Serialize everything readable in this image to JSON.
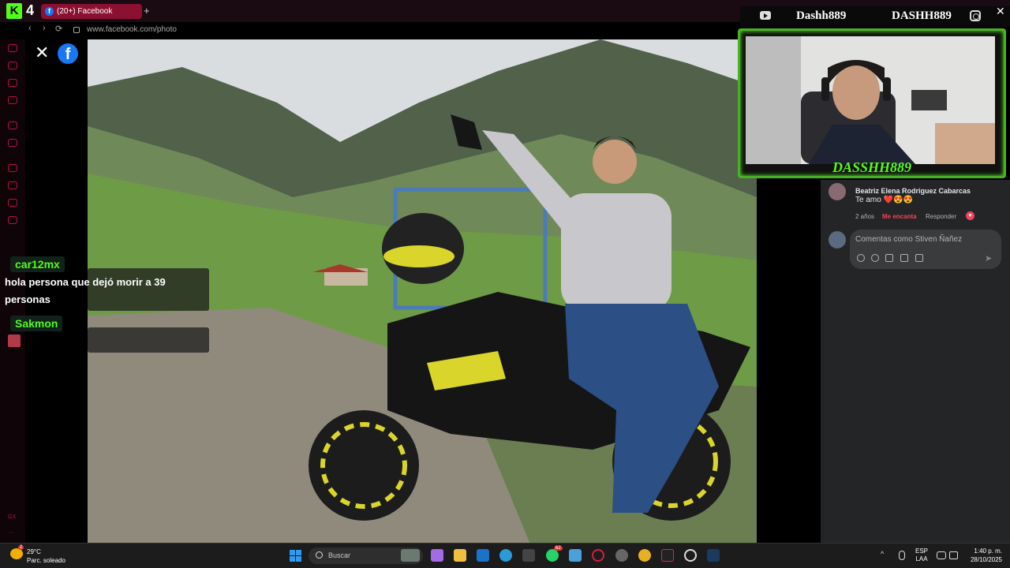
{
  "browser": {
    "brand_letter": "K",
    "brand_number": "4",
    "tab_title": "(20+) Facebook",
    "tab_plus": "+",
    "url": "www.facebook.com/photo",
    "nav_back": "‹",
    "nav_forward": "›",
    "nav_reload": "⟳"
  },
  "rail": {
    "bottom_label": "GX",
    "more_label": "···"
  },
  "facebook": {
    "close_glyph": "✕",
    "logo_letter": "f",
    "comment": {
      "author": "Beatriz Elena Rodriguez Cabarcas",
      "text": "Te amo ❤️😍😍",
      "time": "2 años",
      "reaction": "Me encanta",
      "reply": "Responder",
      "badge": "♥"
    },
    "composer": {
      "placeholder": "Comentas como Stiven Ñañez",
      "send_glyph": "➤"
    }
  },
  "chat": {
    "messages": [
      {
        "user": "car12mx",
        "text": "hola persona que dejó morir a 39 personas"
      },
      {
        "user": "Sakmon",
        "text": ""
      }
    ]
  },
  "stream_overlay": {
    "youtube_handle": "Dashh889",
    "instagram_handle": "DASHH889",
    "cam_label": "DASSHH889",
    "close_glyph": "✕"
  },
  "taskbar": {
    "weather_temp": "29°C",
    "weather_desc": "Parc. soleado",
    "weather_badge": "2",
    "search_label": "Buscar",
    "whatsapp_badge": "62",
    "lang_line1": "ESP",
    "lang_line2": "LAA",
    "time": "1:40 p. m.",
    "date": "28/10/2025",
    "tray_chevron": "^"
  },
  "colors": {
    "kick_green": "#53fc18",
    "facebook_blue": "#1877f2",
    "love_red": "#f3425f",
    "tab_red": "#8c1032"
  },
  "icons": [
    "kick-logo",
    "facebook-icon",
    "youtube-icon",
    "instagram-icon",
    "windows-start-icon",
    "search-icon",
    "send-icon",
    "heart-icon",
    "weather-icon"
  ]
}
